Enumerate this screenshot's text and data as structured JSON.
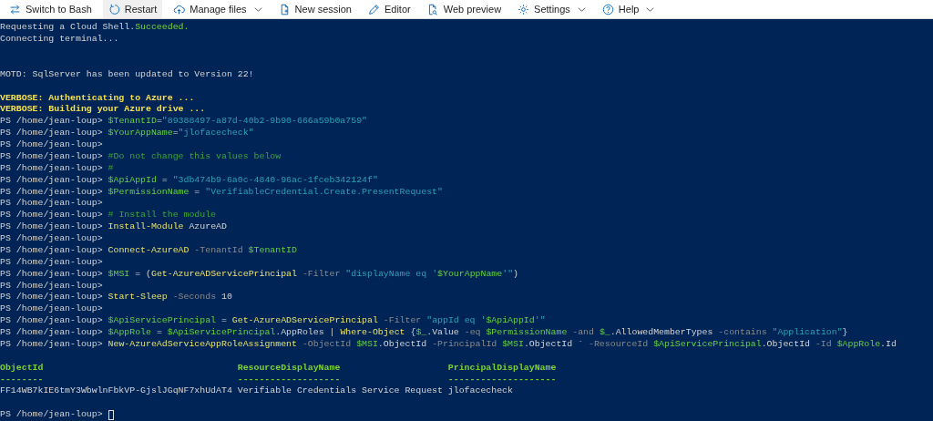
{
  "toolbar": {
    "items": [
      {
        "label": "Switch to Bash",
        "highlighted": false,
        "dropdown": false
      },
      {
        "label": "Restart",
        "highlighted": true,
        "dropdown": false
      },
      {
        "label": "Manage files",
        "highlighted": false,
        "dropdown": true
      },
      {
        "label": "New session",
        "highlighted": false,
        "dropdown": false
      },
      {
        "label": "Editor",
        "highlighted": false,
        "dropdown": false
      },
      {
        "label": "Web preview",
        "highlighted": false,
        "dropdown": false
      },
      {
        "label": "Settings",
        "highlighted": false,
        "dropdown": true
      },
      {
        "label": "Help",
        "highlighted": false,
        "dropdown": true
      }
    ]
  },
  "terminal": {
    "lines": [
      {
        "kind": "output",
        "segments": [
          {
            "kind": "plain",
            "text": "Requesting a Cloud Shell."
          },
          {
            "kind": "success",
            "text": "Succeeded."
          }
        ]
      },
      {
        "kind": "output",
        "segments": [
          {
            "kind": "plain",
            "text": "Connecting terminal..."
          }
        ]
      },
      {
        "kind": "blank"
      },
      {
        "kind": "blank"
      },
      {
        "kind": "output",
        "segments": [
          {
            "kind": "plain",
            "text": "MOTD: SqlServer has been updated to Version 22!"
          }
        ]
      },
      {
        "kind": "blank"
      },
      {
        "kind": "output",
        "segments": [
          {
            "kind": "verbose",
            "text": "VERBOSE: Authenticating to Azure ..."
          }
        ]
      },
      {
        "kind": "output",
        "segments": [
          {
            "kind": "verbose",
            "text": "VERBOSE: Building your Azure drive ..."
          }
        ]
      },
      {
        "kind": "output",
        "segments": [
          {
            "kind": "plain",
            "text": "PS /home/jean-loup> "
          },
          {
            "kind": "variable",
            "text": "$TenantID"
          },
          {
            "kind": "plain",
            "text": "="
          },
          {
            "kind": "string",
            "text": "\"89388497-a87d-40b2-9b90-666a59b0a759\""
          }
        ]
      },
      {
        "kind": "output",
        "segments": [
          {
            "kind": "plain",
            "text": "PS /home/jean-loup> "
          },
          {
            "kind": "variable",
            "text": "$YourAppName"
          },
          {
            "kind": "plain",
            "text": "="
          },
          {
            "kind": "string",
            "text": "\"jlofacecheck\""
          }
        ]
      },
      {
        "kind": "output",
        "segments": [
          {
            "kind": "plain",
            "text": "PS /home/jean-loup>"
          }
        ]
      },
      {
        "kind": "output",
        "segments": [
          {
            "kind": "plain",
            "text": "PS /home/jean-loup> "
          },
          {
            "kind": "comment",
            "text": "#Do not change this values below"
          }
        ]
      },
      {
        "kind": "output",
        "segments": [
          {
            "kind": "plain",
            "text": "PS /home/jean-loup> "
          },
          {
            "kind": "comment",
            "text": "#"
          }
        ]
      },
      {
        "kind": "output",
        "segments": [
          {
            "kind": "plain",
            "text": "PS /home/jean-loup> "
          },
          {
            "kind": "variable",
            "text": "$ApiAppId"
          },
          {
            "kind": "plain",
            "text": " = "
          },
          {
            "kind": "string",
            "text": "\"3db474b9-6a0c-4840-96ac-1fceb342124f\""
          }
        ]
      },
      {
        "kind": "output",
        "segments": [
          {
            "kind": "plain",
            "text": "PS /home/jean-loup> "
          },
          {
            "kind": "variable",
            "text": "$PermissionName"
          },
          {
            "kind": "plain",
            "text": " = "
          },
          {
            "kind": "string",
            "text": "\"VerifiableCredential.Create.PresentRequest\""
          }
        ]
      },
      {
        "kind": "output",
        "segments": [
          {
            "kind": "plain",
            "text": "PS /home/jean-loup>"
          }
        ]
      },
      {
        "kind": "output",
        "segments": [
          {
            "kind": "plain",
            "text": "PS /home/jean-loup> "
          },
          {
            "kind": "comment",
            "text": "# Install the module"
          }
        ]
      },
      {
        "kind": "output",
        "segments": [
          {
            "kind": "plain",
            "text": "PS /home/jean-loup> "
          },
          {
            "kind": "command",
            "text": "Install-Module"
          },
          {
            "kind": "plain",
            "text": " AzureAD"
          }
        ]
      },
      {
        "kind": "output",
        "segments": [
          {
            "kind": "plain",
            "text": "PS /home/jean-loup>"
          }
        ]
      },
      {
        "kind": "output",
        "segments": [
          {
            "kind": "plain",
            "text": "PS /home/jean-loup> "
          },
          {
            "kind": "command",
            "text": "Connect-AzureAD"
          },
          {
            "kind": "parameter",
            "text": " -TenantId "
          },
          {
            "kind": "variable",
            "text": "$TenantID"
          }
        ]
      },
      {
        "kind": "output",
        "segments": [
          {
            "kind": "plain",
            "text": "PS /home/jean-loup>"
          }
        ]
      },
      {
        "kind": "output",
        "segments": [
          {
            "kind": "plain",
            "text": "PS /home/jean-loup> "
          },
          {
            "kind": "variable",
            "text": "$MSI"
          },
          {
            "kind": "plain",
            "text": " = ("
          },
          {
            "kind": "command",
            "text": "Get-AzureADServicePrincipal"
          },
          {
            "kind": "parameter",
            "text": " -Filter "
          },
          {
            "kind": "string",
            "text": "\"displayName eq '"
          },
          {
            "kind": "variable",
            "text": "$YourAppName"
          },
          {
            "kind": "string",
            "text": "'\""
          },
          {
            "kind": "plain",
            "text": ")"
          }
        ]
      },
      {
        "kind": "output",
        "segments": [
          {
            "kind": "plain",
            "text": "PS /home/jean-loup>"
          }
        ]
      },
      {
        "kind": "output",
        "segments": [
          {
            "kind": "plain",
            "text": "PS /home/jean-loup> "
          },
          {
            "kind": "command",
            "text": "Start-Sleep"
          },
          {
            "kind": "parameter",
            "text": " -Seconds "
          },
          {
            "kind": "plain",
            "text": "10"
          }
        ]
      },
      {
        "kind": "output",
        "segments": [
          {
            "kind": "plain",
            "text": "PS /home/jean-loup>"
          }
        ]
      },
      {
        "kind": "output",
        "segments": [
          {
            "kind": "plain",
            "text": "PS /home/jean-loup> "
          },
          {
            "kind": "variable",
            "text": "$ApiServicePrincipal"
          },
          {
            "kind": "plain",
            "text": " = "
          },
          {
            "kind": "command",
            "text": "Get-AzureADServicePrincipal"
          },
          {
            "kind": "parameter",
            "text": " -Filter "
          },
          {
            "kind": "string",
            "text": "\"appId eq '"
          },
          {
            "kind": "variable",
            "text": "$ApiAppId"
          },
          {
            "kind": "string",
            "text": "'\""
          }
        ]
      },
      {
        "kind": "output",
        "segments": [
          {
            "kind": "plain",
            "text": "PS /home/jean-loup> "
          },
          {
            "kind": "variable",
            "text": "$AppRole"
          },
          {
            "kind": "plain",
            "text": " = "
          },
          {
            "kind": "variable",
            "text": "$ApiServicePrincipal"
          },
          {
            "kind": "plain",
            "text": ".AppRoles | "
          },
          {
            "kind": "command",
            "text": "Where-Object"
          },
          {
            "kind": "plain",
            "text": " {"
          },
          {
            "kind": "variable",
            "text": "$_"
          },
          {
            "kind": "plain",
            "text": ".Value "
          },
          {
            "kind": "parameter",
            "text": "-eq "
          },
          {
            "kind": "variable",
            "text": "$PermissionName"
          },
          {
            "kind": "parameter",
            "text": " -and "
          },
          {
            "kind": "variable",
            "text": "$_"
          },
          {
            "kind": "plain",
            "text": ".AllowedMemberTypes "
          },
          {
            "kind": "parameter",
            "text": "-contains "
          },
          {
            "kind": "string",
            "text": "\"Application\""
          },
          {
            "kind": "plain",
            "text": "}"
          }
        ]
      },
      {
        "kind": "output",
        "segments": [
          {
            "kind": "plain",
            "text": "PS /home/jean-loup> "
          },
          {
            "kind": "command",
            "text": "New-AzureAdServiceAppRoleAssignment"
          },
          {
            "kind": "parameter",
            "text": " -ObjectId "
          },
          {
            "kind": "variable",
            "text": "$MSI"
          },
          {
            "kind": "plain",
            "text": ".ObjectId "
          },
          {
            "kind": "parameter",
            "text": "-PrincipalId "
          },
          {
            "kind": "variable",
            "text": "$MSI"
          },
          {
            "kind": "plain",
            "text": ".ObjectId ` "
          },
          {
            "kind": "parameter",
            "text": "-ResourceId "
          },
          {
            "kind": "variable",
            "text": "$ApiServicePrincipal"
          },
          {
            "kind": "plain",
            "text": ".ObjectId "
          },
          {
            "kind": "parameter",
            "text": "-Id "
          },
          {
            "kind": "variable",
            "text": "$AppRole"
          },
          {
            "kind": "plain",
            "text": ".Id"
          }
        ]
      },
      {
        "kind": "blank"
      },
      {
        "kind": "table",
        "columns": [
          {
            "heading": "ObjectId",
            "underline": "--------"
          },
          {
            "heading": "ResourceDisplayName",
            "underline": "-------------------"
          },
          {
            "heading": "PrincipalDisplayName",
            "underline": "--------------------"
          }
        ],
        "rows": [
          [
            "FF14WB7kIE6tmY3WbwlnFbkVP-GjslJGqNF7xhUdAT4",
            "Verifiable Credentials Service Request",
            "jlofacecheck"
          ]
        ]
      },
      {
        "kind": "blank"
      },
      {
        "kind": "cursor",
        "prompt": "PS /home/jean-loup> "
      }
    ]
  }
}
